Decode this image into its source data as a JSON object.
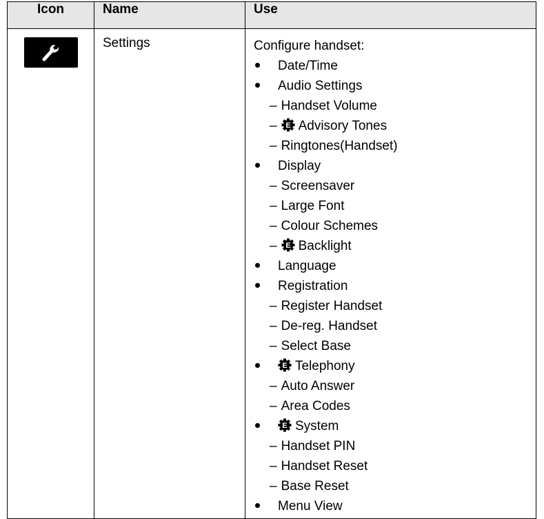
{
  "table": {
    "headers": {
      "icon": "Icon",
      "name": "Name",
      "use": "Use"
    },
    "row": {
      "icon": "wrench-icon",
      "name": "Settings",
      "intro": "Configure handset:",
      "items": [
        {
          "type": "bullet",
          "text": "Date/Time",
          "e": false
        },
        {
          "type": "bullet",
          "text": "Audio Settings",
          "e": false
        },
        {
          "type": "sub",
          "text": "Handset Volume",
          "e": false
        },
        {
          "type": "sub",
          "text": "Advisory Tones",
          "e": true
        },
        {
          "type": "sub",
          "text": "Ringtones(Handset)",
          "e": false
        },
        {
          "type": "bullet",
          "text": "Display",
          "e": false
        },
        {
          "type": "sub",
          "text": "Screensaver",
          "e": false
        },
        {
          "type": "sub",
          "text": "Large Font",
          "e": false
        },
        {
          "type": "sub",
          "text": "Colour Schemes",
          "e": false
        },
        {
          "type": "sub",
          "text": "Backlight",
          "e": true
        },
        {
          "type": "bullet",
          "text": "Language",
          "e": false
        },
        {
          "type": "bullet",
          "text": "Registration",
          "e": false
        },
        {
          "type": "sub",
          "text": "Register Handset",
          "e": false
        },
        {
          "type": "sub",
          "text": "De-reg. Handset",
          "e": false
        },
        {
          "type": "sub",
          "text": "Select Base",
          "e": false
        },
        {
          "type": "bullet",
          "text": "Telephony",
          "e": true
        },
        {
          "type": "sub",
          "text": "Auto Answer",
          "e": false
        },
        {
          "type": "sub",
          "text": "Area Codes",
          "e": false
        },
        {
          "type": "bullet",
          "text": "System",
          "e": true
        },
        {
          "type": "sub",
          "text": "Handset PIN",
          "e": false
        },
        {
          "type": "sub",
          "text": "Handset Reset",
          "e": false
        },
        {
          "type": "sub",
          "text": "Base Reset",
          "e": false
        },
        {
          "type": "bullet",
          "text": "Menu View",
          "e": false
        }
      ],
      "dash": "–",
      "e_badge_letter": "E"
    }
  }
}
